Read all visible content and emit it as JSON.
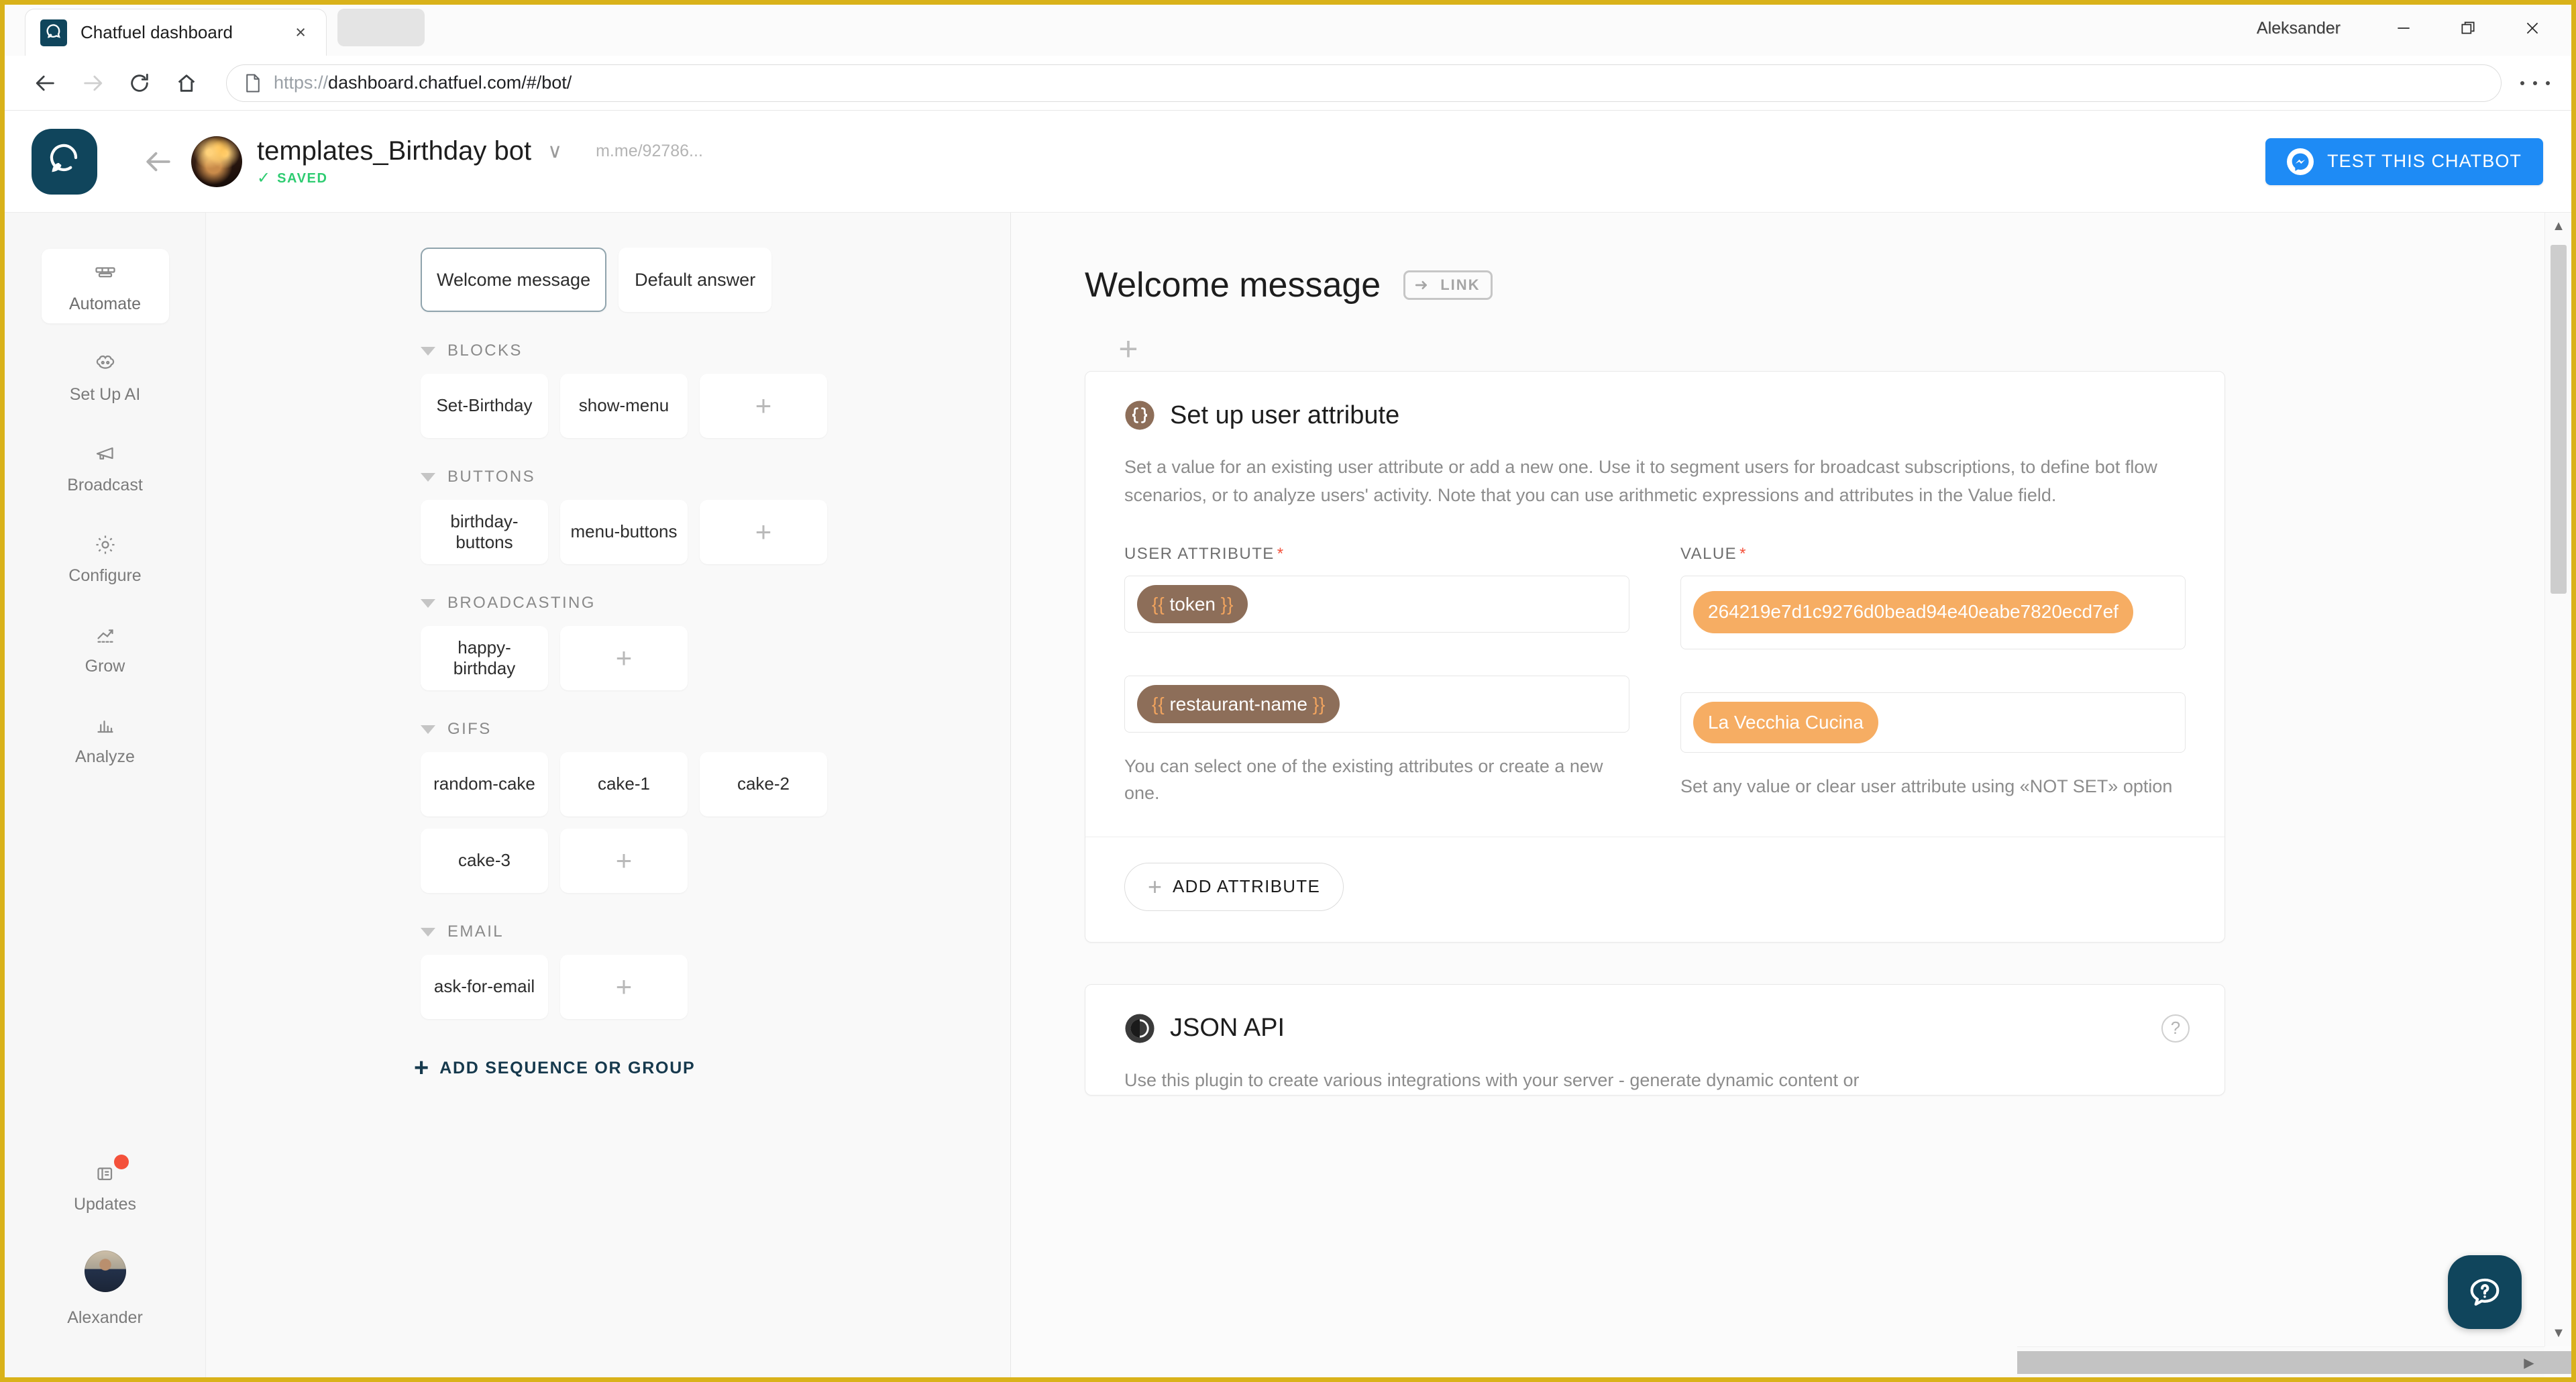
{
  "browser": {
    "tab_title": "Chatfuel dashboard",
    "tab_close": "×",
    "url_scheme": "https://",
    "url_rest": "dashboard.chatfuel.com/#/bot/",
    "profile_name": "Aleksander",
    "icons": {
      "favicon": "chatfuel-logo-icon",
      "back": "back-arrow-icon",
      "forward": "forward-arrow-icon",
      "reload": "reload-icon",
      "home": "home-icon",
      "page_info": "document-icon",
      "menu": "kebab-menu-icon",
      "minimize": "minimize-icon",
      "maximize": "maximize-icon",
      "close": "close-icon"
    }
  },
  "header": {
    "bot_title": "templates_Birthday bot",
    "dropdown_caret": "∨",
    "mme_link": "m.me/92786...",
    "saved_check": "✓",
    "saved_label": "SAVED",
    "test_button_label": "TEST THIS CHATBOT"
  },
  "rail": {
    "items": [
      {
        "label": "Automate",
        "icon": "automate-icon",
        "active": true
      },
      {
        "label": "Set Up AI",
        "icon": "ai-brain-icon",
        "active": false
      },
      {
        "label": "Broadcast",
        "icon": "megaphone-icon",
        "active": false
      },
      {
        "label": "Configure",
        "icon": "gear-icon",
        "active": false
      },
      {
        "label": "Grow",
        "icon": "trend-up-icon",
        "active": false
      },
      {
        "label": "Analyze",
        "icon": "bar-chart-icon",
        "active": false
      }
    ],
    "updates_label": "Updates",
    "user_label": "Alexander"
  },
  "panel": {
    "tabs": [
      {
        "label": "Welcome message",
        "selected": true
      },
      {
        "label": "Default answer",
        "selected": false
      }
    ],
    "groups": [
      {
        "title": "BLOCKS",
        "chips": [
          "Set-Birthday",
          "show-menu"
        ]
      },
      {
        "title": "BUTTONS",
        "chips": [
          "birthday-buttons",
          "menu-buttons"
        ]
      },
      {
        "title": "BROADCASTING",
        "chips": [
          "happy-birthday"
        ]
      },
      {
        "title": "GIFS",
        "chips": [
          "random-cake",
          "cake-1",
          "cake-2",
          "cake-3"
        ]
      },
      {
        "title": "EMAIL",
        "chips": [
          "ask-for-email"
        ]
      }
    ],
    "add_chip_symbol": "+",
    "add_sequence_plus": "+",
    "add_sequence_label": "ADD SEQUENCE OR GROUP"
  },
  "content": {
    "title": "Welcome message",
    "link_badge": "LINK",
    "add_plugin_symbol": "+",
    "attribute_plugin": {
      "title": "Set up user attribute",
      "icon": "curly-braces-icon",
      "description": "Set a value for an existing user attribute or add a new one. Use it to segment users for broadcast subscriptions, to define bot flow scenarios, or to analyze users' activity. Note that you can use arithmetic expressions and attributes in the Value field.",
      "col_attribute_label": "USER ATTRIBUTE",
      "col_value_label": "VALUE",
      "required_mark": "*",
      "rows": [
        {
          "attribute_open": "{{",
          "attribute": "token",
          "attribute_close": "}}",
          "value": "264219e7d1c9276d0bead94e40eabe7820ecd7ef"
        },
        {
          "attribute_open": "{{",
          "attribute": "restaurant-name",
          "attribute_close": "}}",
          "value": "La Vecchia Cucina"
        }
      ],
      "hint_attribute": "You can select one of the existing attributes or create a new one.",
      "hint_value": "Set any value or clear user attribute using «NOT SET» option",
      "add_attribute_plus": "+",
      "add_attribute_label": "ADD ATTRIBUTE"
    },
    "json_plugin": {
      "title": "JSON API",
      "icon": "json-api-icon",
      "help_symbol": "?",
      "description": "Use this plugin to create various integrations with your server - generate dynamic content or"
    }
  },
  "scrollbars": {
    "v_up": "▲",
    "v_down": "▼",
    "h_right": "▶"
  },
  "help_fab": {
    "icon": "help-bubble-icon"
  },
  "colors": {
    "brand_dark": "#10455c",
    "messenger_blue": "#1e8bf5",
    "saved_green": "#2ecc71",
    "required_red": "#f4513b",
    "attribute_chip": "#8d6e59",
    "value_chip": "#f6ad63",
    "window_frame": "#d9b21a"
  }
}
